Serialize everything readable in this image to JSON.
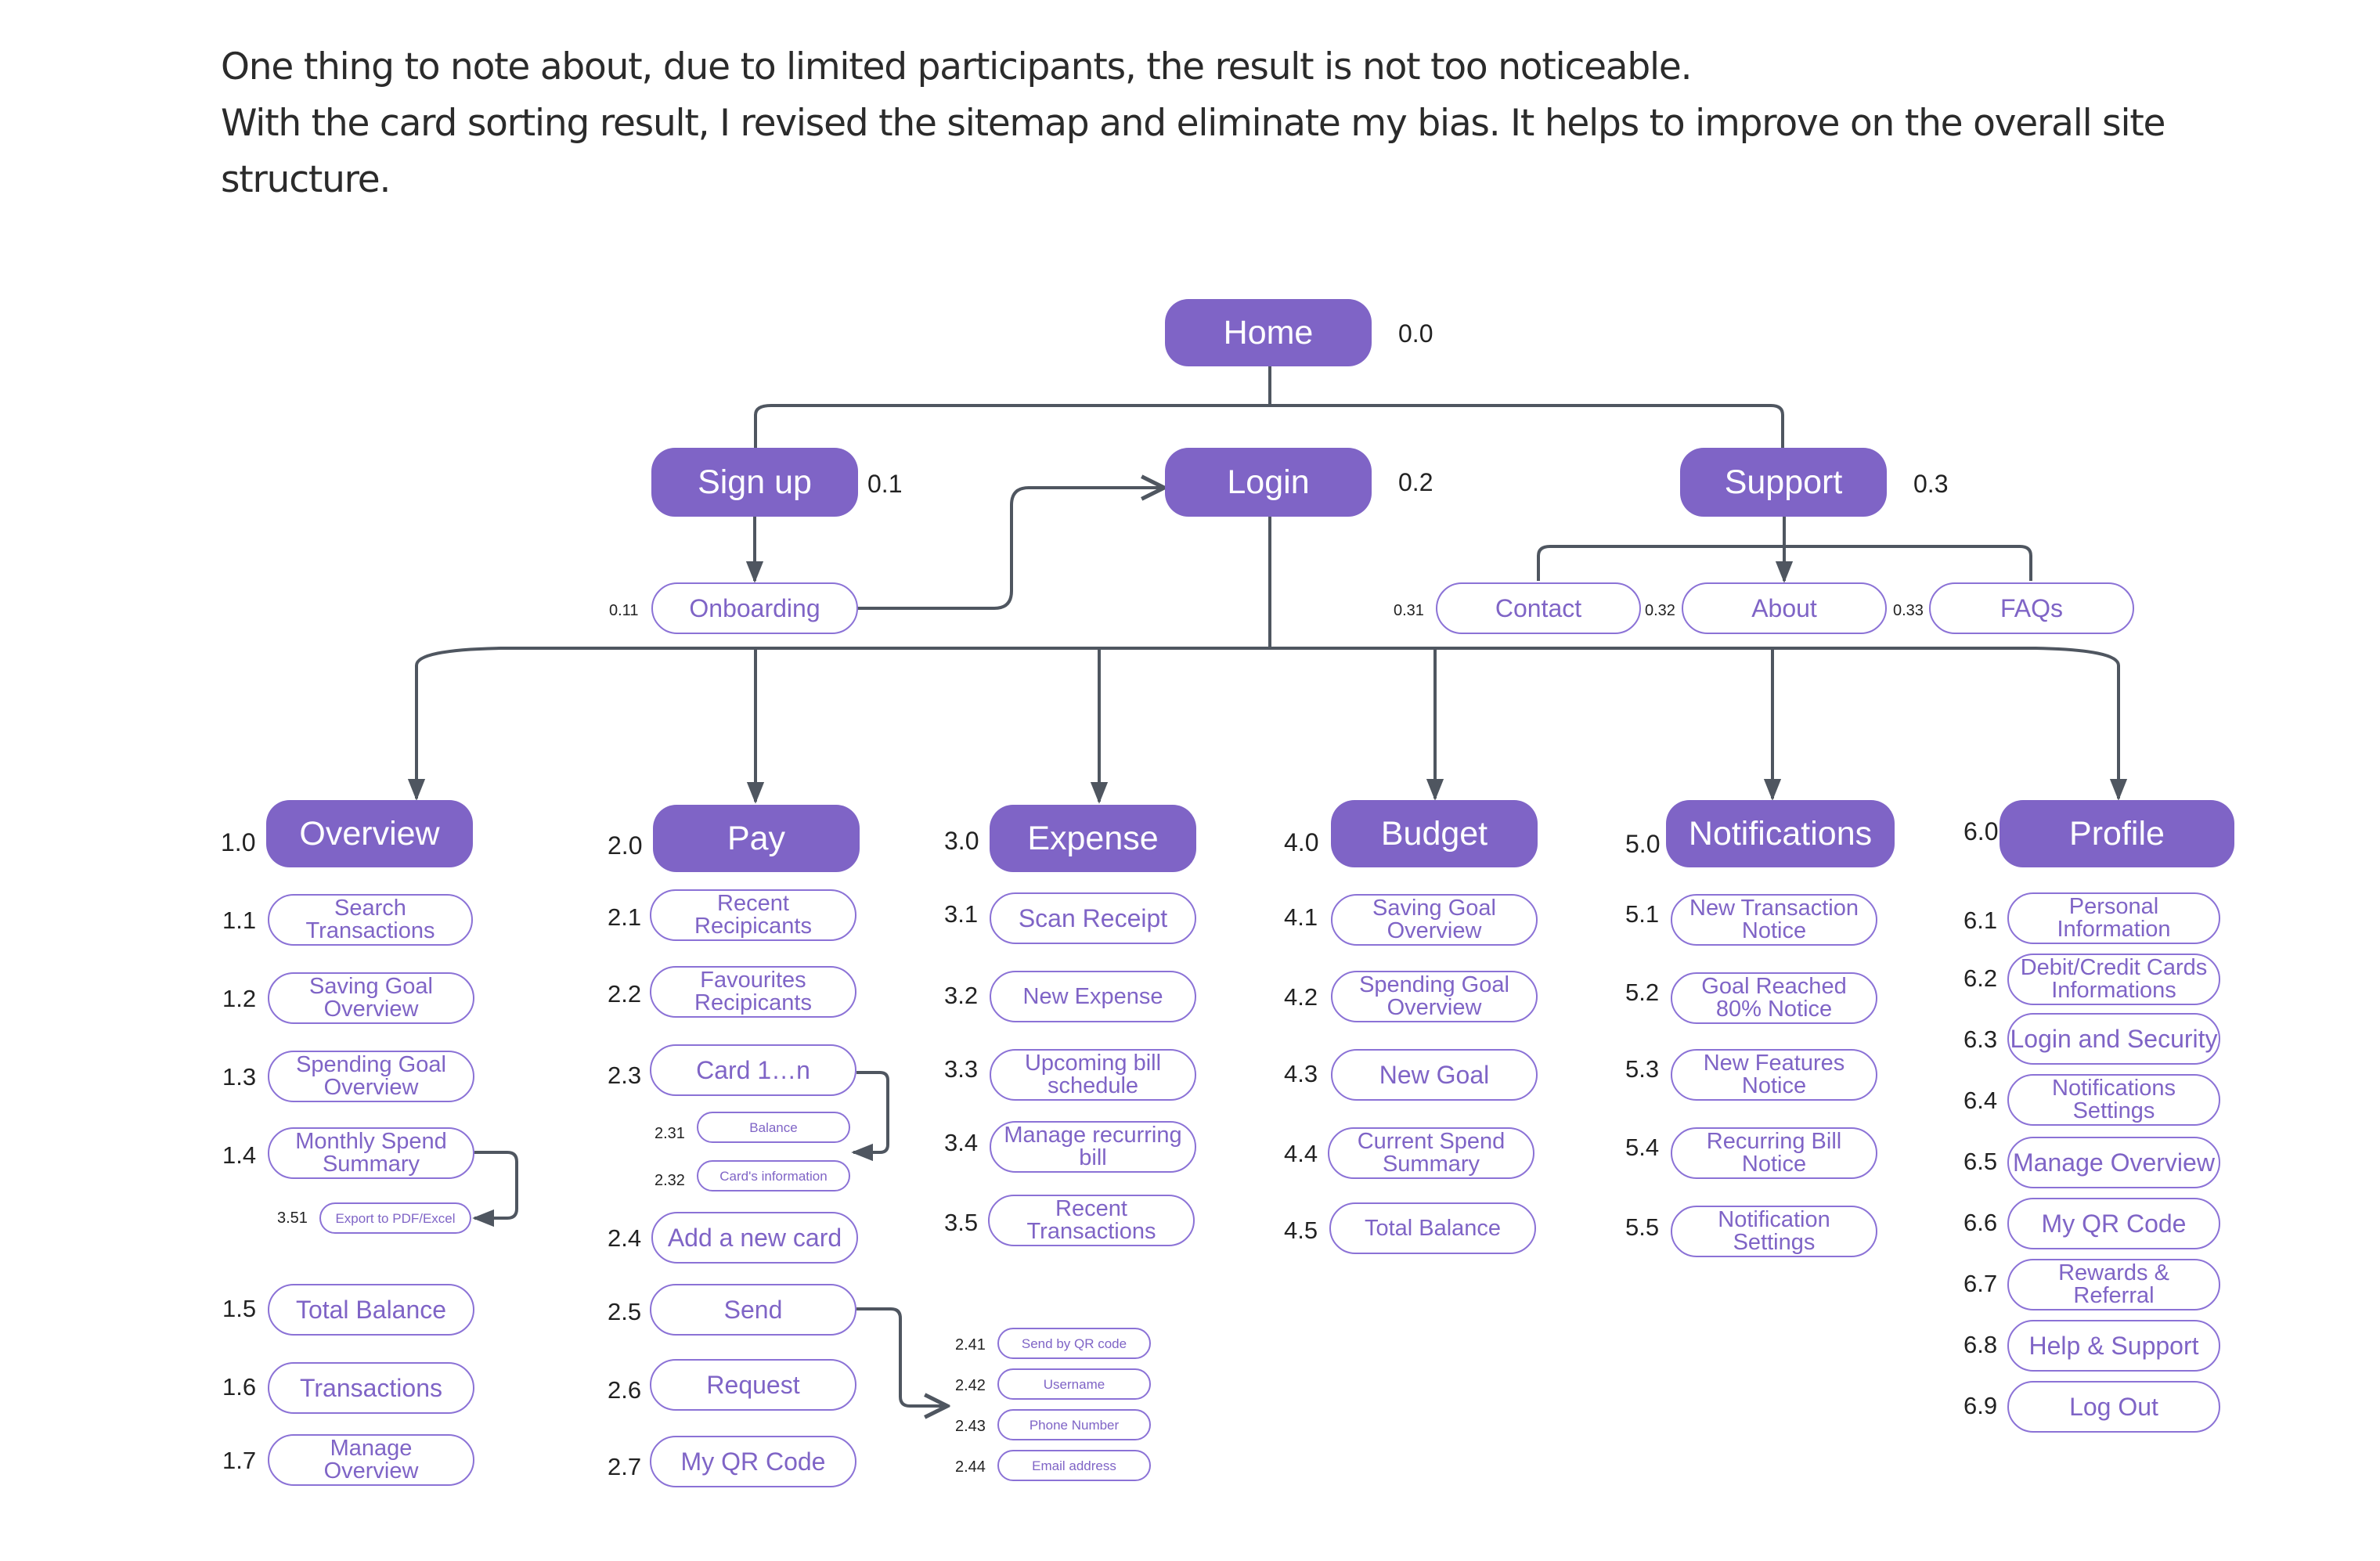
{
  "intro": {
    "line1": "One thing to note about, due to limited participants, the result is not too noticeable.",
    "line2": "With the card sorting result, I revised the sitemap and eliminate my bias. It helps to improve on the overall site structure."
  },
  "colors": {
    "primary_node_fill": "#7f64c6",
    "secondary_node_border": "#8b72d6",
    "secondary_node_text": "#7f64c6",
    "connector": "#4f5660",
    "body_text": "#2b2b2b"
  },
  "sitemap": {
    "home": {
      "id": "0.0",
      "label": "Home"
    },
    "top": [
      {
        "id": "0.1",
        "label": "Sign up",
        "children": [
          {
            "id": "0.11",
            "label": "Onboarding"
          }
        ]
      },
      {
        "id": "0.2",
        "label": "Login"
      },
      {
        "id": "0.3",
        "label": "Support",
        "children": [
          {
            "id": "0.31",
            "label": "Contact"
          },
          {
            "id": "0.32",
            "label": "About"
          },
          {
            "id": "0.33",
            "label": "FAQs"
          }
        ]
      }
    ],
    "sections": [
      {
        "id": "1.0",
        "label": "Overview",
        "items": [
          {
            "id": "1.1",
            "label": "Search\nTransactions"
          },
          {
            "id": "1.2",
            "label": "Saving Goal\nOverview"
          },
          {
            "id": "1.3",
            "label": "Spending Goal\nOverview"
          },
          {
            "id": "1.4",
            "label": "Monthly Spend\nSummary",
            "sub": [
              {
                "id": "3.51",
                "label": "Export to PDF/Excel"
              }
            ]
          },
          {
            "id": "1.5",
            "label": "Total Balance"
          },
          {
            "id": "1.6",
            "label": "Transactions"
          },
          {
            "id": "1.7",
            "label": "Manage\nOverview"
          }
        ]
      },
      {
        "id": "2.0",
        "label": "Pay",
        "items": [
          {
            "id": "2.1",
            "label": "Recent\nRecipicants"
          },
          {
            "id": "2.2",
            "label": "Favourites\nRecipicants"
          },
          {
            "id": "2.3",
            "label": "Card 1…n",
            "sub": [
              {
                "id": "2.31",
                "label": "Balance"
              },
              {
                "id": "2.32",
                "label": "Card's information"
              }
            ]
          },
          {
            "id": "2.4",
            "label": "Add a new card"
          },
          {
            "id": "2.5",
            "label": "Send",
            "sub": [
              {
                "id": "2.41",
                "label": "Send by QR code"
              },
              {
                "id": "2.42",
                "label": "Username"
              },
              {
                "id": "2.43",
                "label": "Phone Number"
              },
              {
                "id": "2.44",
                "label": "Email address"
              }
            ]
          },
          {
            "id": "2.6",
            "label": "Request"
          },
          {
            "id": "2.7",
            "label": "My QR Code"
          }
        ]
      },
      {
        "id": "3.0",
        "label": "Expense",
        "items": [
          {
            "id": "3.1",
            "label": "Scan Receipt"
          },
          {
            "id": "3.2",
            "label": "New Expense"
          },
          {
            "id": "3.3",
            "label": "Upcoming bill\nschedule"
          },
          {
            "id": "3.4",
            "label": "Manage recurring\nbill"
          },
          {
            "id": "3.5",
            "label": "Recent\nTransactions"
          }
        ]
      },
      {
        "id": "4.0",
        "label": "Budget",
        "items": [
          {
            "id": "4.1",
            "label": "Saving Goal\nOverview"
          },
          {
            "id": "4.2",
            "label": "Spending Goal\nOverview"
          },
          {
            "id": "4.3",
            "label": "New Goal"
          },
          {
            "id": "4.4",
            "label": "Current Spend\nSummary"
          },
          {
            "id": "4.5",
            "label": "Total Balance"
          }
        ]
      },
      {
        "id": "5.0",
        "label": "Notifications",
        "items": [
          {
            "id": "5.1",
            "label": "New Transaction\nNotice"
          },
          {
            "id": "5.2",
            "label": "Goal Reached\n80% Notice"
          },
          {
            "id": "5.3",
            "label": "New Features\nNotice"
          },
          {
            "id": "5.4",
            "label": "Recurring Bill\nNotice"
          },
          {
            "id": "5.5",
            "label": "Notification\nSettings"
          }
        ]
      },
      {
        "id": "6.0",
        "label": "Profile",
        "items": [
          {
            "id": "6.1",
            "label": "Personal\nInformation"
          },
          {
            "id": "6.2",
            "label": "Debit/Credit Cards\nInformations"
          },
          {
            "id": "6.3",
            "label": "Login and Security"
          },
          {
            "id": "6.4",
            "label": "Notifications\nSettings"
          },
          {
            "id": "6.5",
            "label": "Manage Overview"
          },
          {
            "id": "6.6",
            "label": "My QR Code"
          },
          {
            "id": "6.7",
            "label": "Rewards &\nReferral"
          },
          {
            "id": "6.8",
            "label": "Help & Support"
          },
          {
            "id": "6.9",
            "label": "Log Out"
          }
        ]
      }
    ]
  }
}
